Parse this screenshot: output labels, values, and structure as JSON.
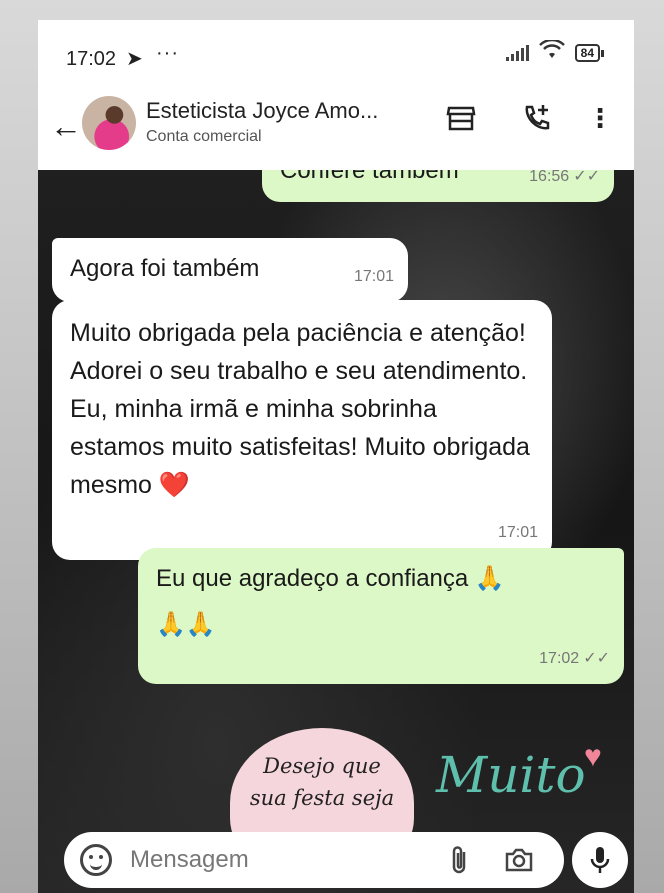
{
  "status_bar": {
    "time": "17:02",
    "battery": "84"
  },
  "header": {
    "contact_name": "Esteticista Joyce Amo...",
    "subtitle": "Conta comercial"
  },
  "messages": [
    {
      "text": "Confere também",
      "time": "16:56",
      "direction": "out"
    },
    {
      "text": "Agora foi também",
      "time": "17:01",
      "direction": "in"
    },
    {
      "text": "Muito obrigada pela paciência e atenção! Adorei o seu trabalho e seu atendimento. Eu, minha irmã e minha sobrinha estamos muito satisfeitas! Muito obrigada mesmo",
      "emoji": "❤️",
      "time": "17:01",
      "direction": "in"
    },
    {
      "text": "Eu que agradeço a confiança",
      "emoji1": "🙏",
      "emoji2": "🙏🙏",
      "time": "17:02",
      "direction": "out"
    }
  ],
  "background_art": {
    "line1": "Desejo que",
    "line2": "sua festa seja",
    "word": "Muito"
  },
  "composer": {
    "placeholder": "Mensagem"
  },
  "icons": [
    "telegram-icon",
    "wifi-icon",
    "back-arrow-icon",
    "store-icon",
    "add-call-icon",
    "more-vert-icon",
    "emoji-icon",
    "attach-icon",
    "camera-icon",
    "mic-icon"
  ],
  "colors": {
    "outgoing": "#dcf8c6",
    "incoming": "#ffffff",
    "header": "#ffffff"
  }
}
